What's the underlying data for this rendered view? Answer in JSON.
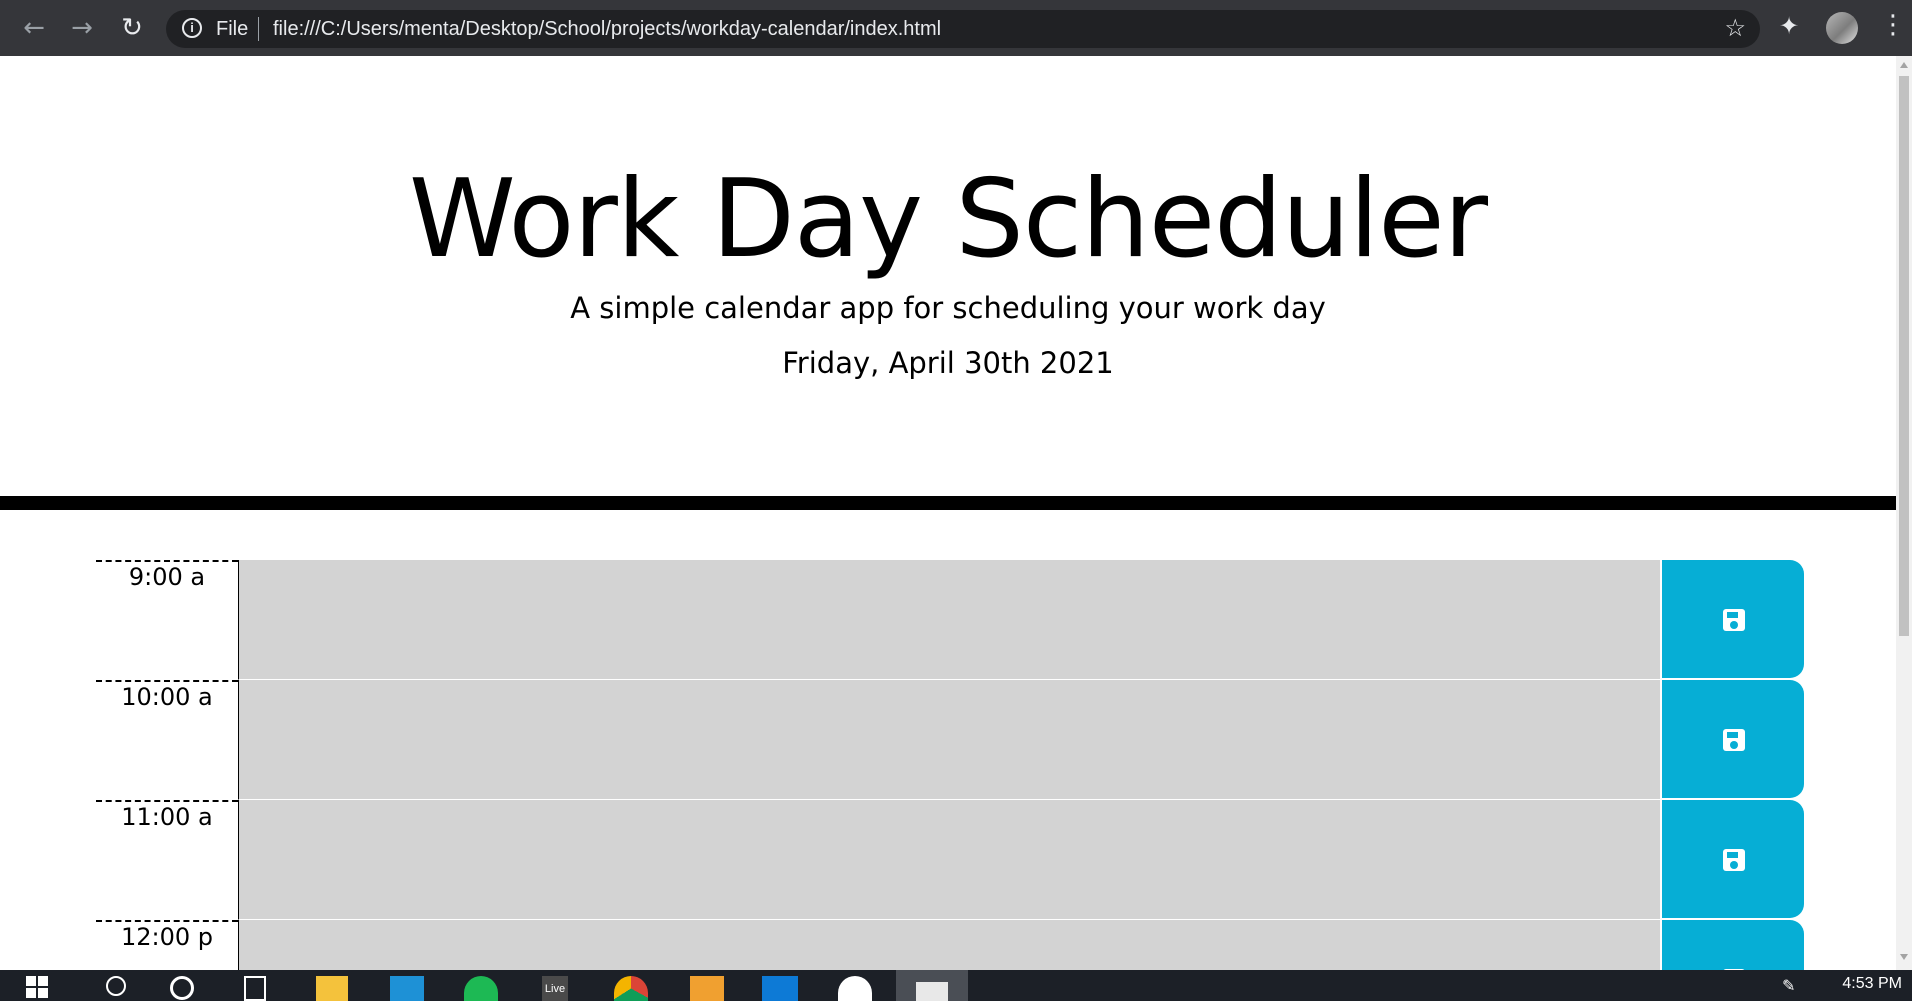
{
  "browser": {
    "file_label": "File",
    "url": "file:///C:/Users/menta/Desktop/School/projects/workday-calendar/index.html"
  },
  "header": {
    "title": "Work Day Scheduler",
    "subtitle": "A simple calendar app for scheduling your work day",
    "date": "Friday, April 30th 2021"
  },
  "schedule": {
    "rows": [
      {
        "hour": "9:00 a",
        "text": ""
      },
      {
        "hour": "10:00 a",
        "text": ""
      },
      {
        "hour": "11:00 a",
        "text": ""
      },
      {
        "hour": "12:00 p",
        "text": ""
      }
    ]
  },
  "taskbar": {
    "time": "4:53 PM",
    "live_label": "Live"
  },
  "colors": {
    "past": "#d3d3d3",
    "save_button": "#06aed5"
  }
}
